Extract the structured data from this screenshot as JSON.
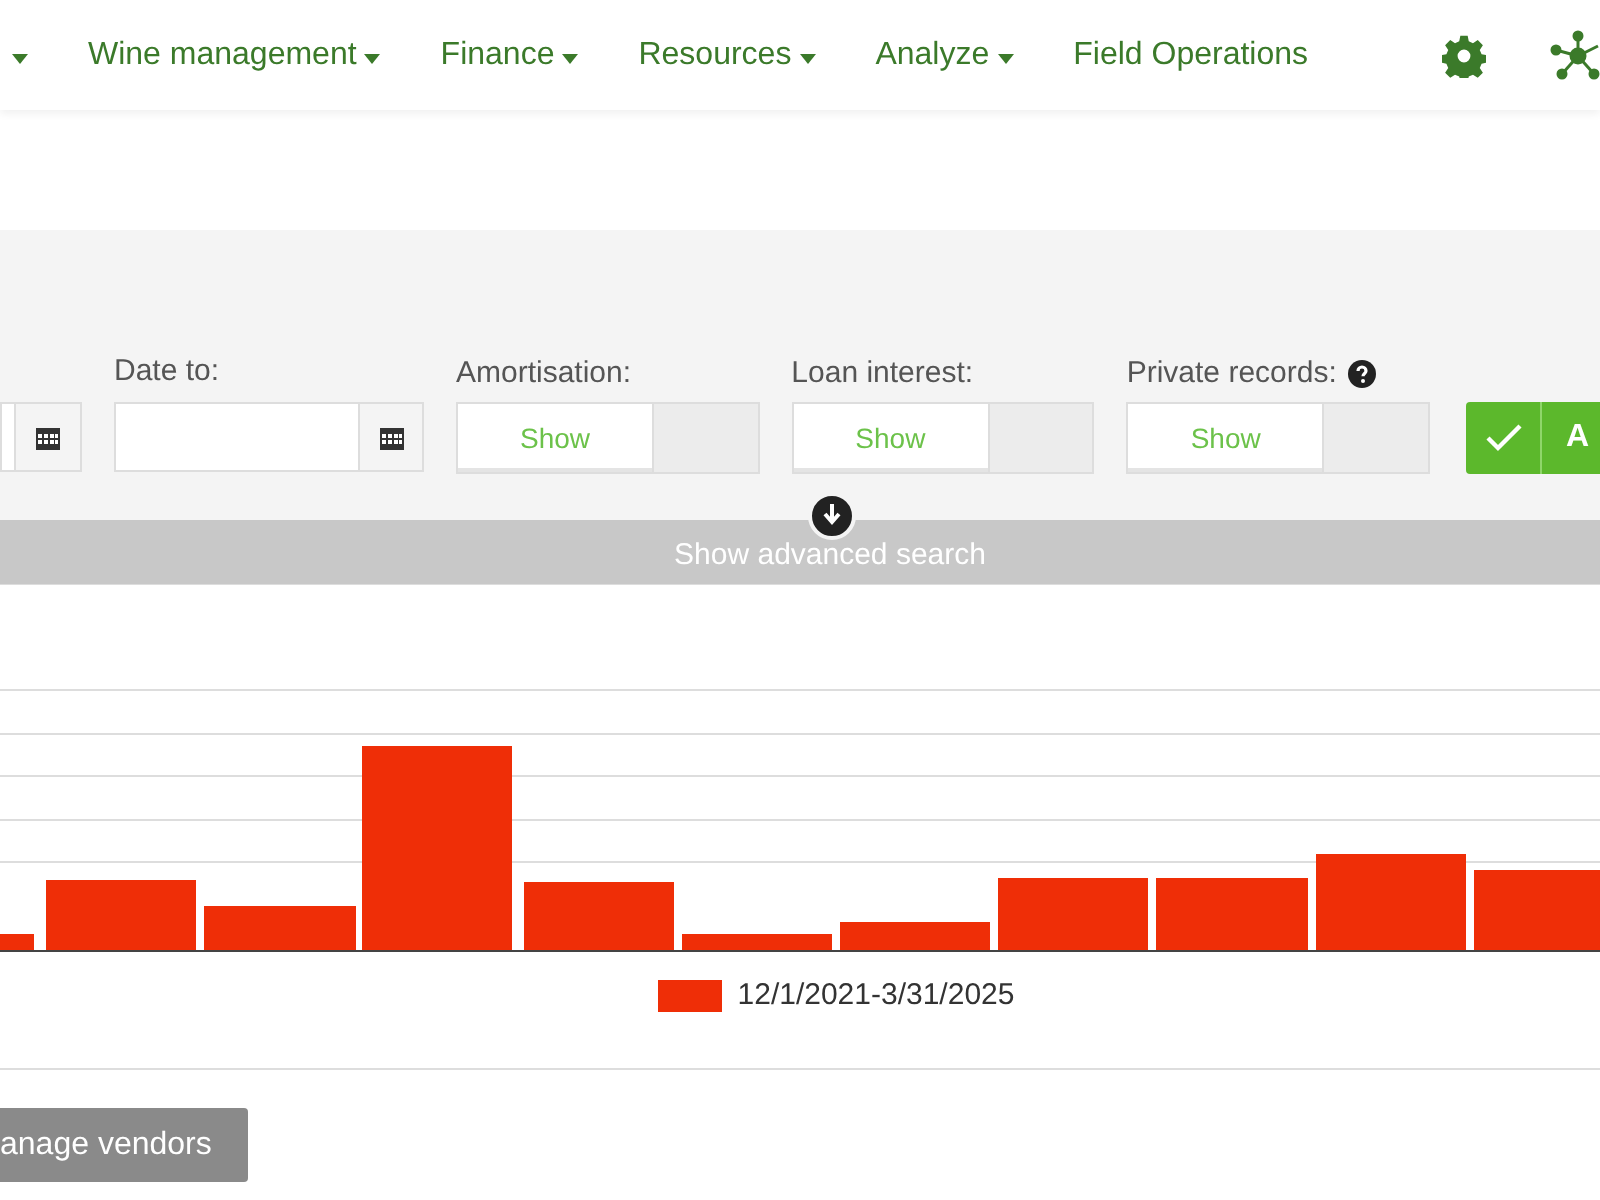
{
  "nav": {
    "items": [
      {
        "dropdown": true
      },
      {
        "label": "Wine management",
        "dropdown": true
      },
      {
        "label": "Finance",
        "dropdown": true
      },
      {
        "label": "Resources",
        "dropdown": true
      },
      {
        "label": "Analyze",
        "dropdown": true
      },
      {
        "label": "Field Operations",
        "dropdown": false
      }
    ]
  },
  "filters": {
    "date_to": {
      "label": "Date to:"
    },
    "toggles": [
      {
        "label": "Amortisation:",
        "help": false,
        "options": [
          {
            "label": "Show",
            "selected": true
          },
          {
            "selected": false
          }
        ]
      },
      {
        "label": "Loan interest:",
        "help": false,
        "options": [
          {
            "label": "Show",
            "selected": true
          },
          {
            "selected": false
          }
        ]
      },
      {
        "label": "Private records:",
        "help": true,
        "options": [
          {
            "label": "Show",
            "selected": true
          },
          {
            "selected": false
          }
        ]
      }
    ],
    "apply_button": "A"
  },
  "advanced_search": "Show advanced search",
  "chart": {
    "legend": "12/1/2021-3/31/2025"
  },
  "manage_button": "anage vendors"
}
